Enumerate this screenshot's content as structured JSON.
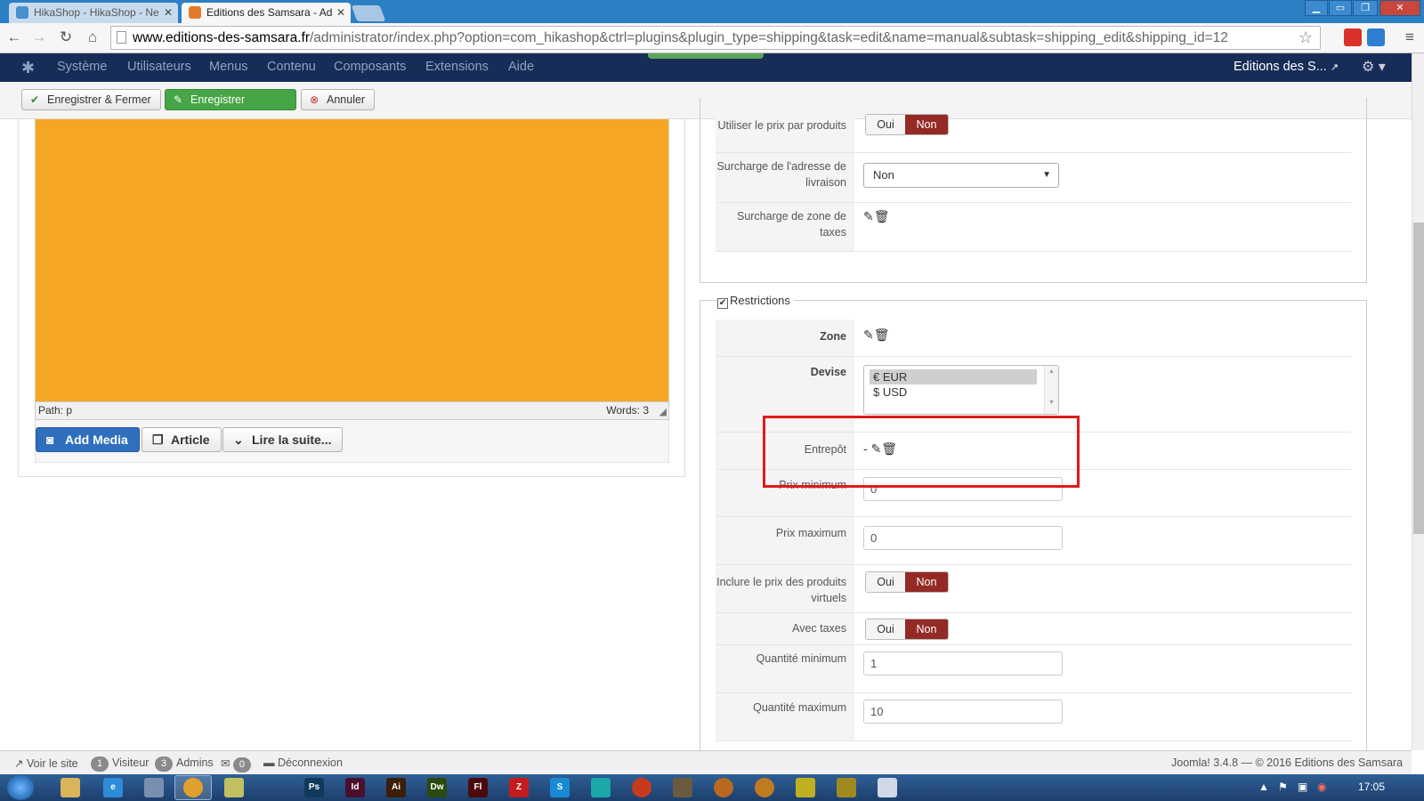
{
  "browser": {
    "tabs": [
      {
        "title": "HikaShop - HikaShop - Ne",
        "active": false
      },
      {
        "title": "Editions des Samsara - Ad",
        "active": true
      }
    ],
    "url_domain": "www.editions-des-samsara.fr",
    "url_path": "/administrator/index.php?option=com_hikashop&ctrl=plugins&plugin_type=shipping&task=edit&name=manual&subtask=shipping_edit&shipping_id=12"
  },
  "admin_nav": {
    "menu": [
      "Système",
      "Utilisateurs",
      "Menus",
      "Contenu",
      "Composants",
      "Extensions",
      "Aide"
    ],
    "site_name": "Editions des S..."
  },
  "toolbar": {
    "save_close_label": "Enregistrer & Fermer",
    "save_label": "Enregistrer",
    "cancel_label": "Annuler"
  },
  "editor": {
    "path_label": "Path:  p",
    "words_label": "Words: 3",
    "add_media_label": "Add Media",
    "article_label": "Article",
    "readmore_label": "Lire la suite..."
  },
  "top_settings": {
    "price_per_product_label": "Utiliser le prix par produits",
    "address_override_label": "Surcharge de l'adresse de livraison",
    "address_override_value": "Non",
    "tax_zone_override_label": "Surcharge de zone de taxes"
  },
  "toggle": {
    "yes": "Oui",
    "no": "Non"
  },
  "restrictions": {
    "legend": "Restrictions",
    "zone_label": "Zone",
    "currency_label": "Devise",
    "currency_options": [
      "€ EUR",
      "$ USD"
    ],
    "warehouse_label": "Entrepôt",
    "warehouse_value": "-",
    "min_price_label": "Prix minimum",
    "min_price_value": "0",
    "max_price_label": "Prix maximum",
    "max_price_value": "0",
    "include_virtual_label": "Inclure le prix des produits virtuels",
    "with_taxes_label": "Avec taxes",
    "min_qty_label": "Quantité minimum",
    "min_qty_value": "1",
    "max_qty_label": "Quantité maximum",
    "max_qty_value": "10"
  },
  "footer": {
    "view_site": "Voir le site",
    "visitors_count": "1",
    "visitors_label": "Visiteur",
    "admins_count": "3",
    "admins_label": "Admins",
    "messages_count": "0",
    "logout": "Déconnexion",
    "version": "Joomla! 3.4.8  —  © 2016 Editions des Samsara"
  },
  "taskbar": {
    "clock": "17:05"
  },
  "colors": {
    "navbar": "#172d57",
    "editor_bg": "#f5a623",
    "toggle_no": "#942a25",
    "highlight_box": "#e01a1a",
    "save_green": "#46a546",
    "add_media_blue": "#2f6fbd"
  }
}
